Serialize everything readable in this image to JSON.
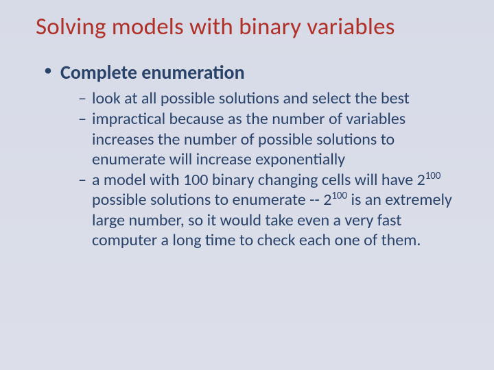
{
  "title": "Solving models with binary variables",
  "bullets": {
    "level1": {
      "item1": "Complete enumeration"
    },
    "level2": {
      "item1": "look at all possible solutions and select the best",
      "item2": "impractical because as the number of variables increases the number of possible solutions to enumerate will increase exponentially",
      "item3_part1": "a model with 100 binary changing cells will have 2",
      "item3_sup1": "100",
      "item3_part2": " possible solutions to enumerate -- 2",
      "item3_sup2": "100",
      "item3_part3": " is an extremely large number, so it would take even a very fast computer a long time to check each one of them."
    }
  }
}
